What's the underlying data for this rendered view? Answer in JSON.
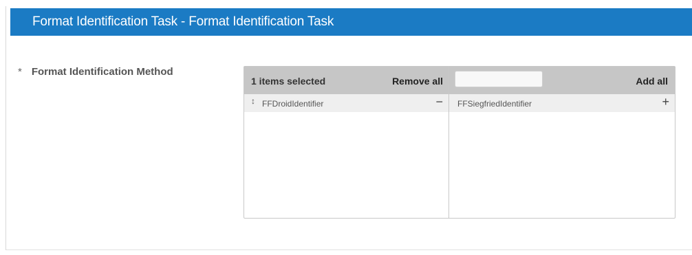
{
  "panel": {
    "title": "Format Identification Task - Format Identification Task"
  },
  "field": {
    "required_mark": "*",
    "label": "Format Identification Method"
  },
  "multiselect": {
    "selected": {
      "count_label": "1 items selected",
      "action_label": "Remove all",
      "items": [
        {
          "label": "FFDroidIdentifier",
          "drag_icon": "drag-handle-icon",
          "action_icon": "minus-icon"
        }
      ]
    },
    "available": {
      "search_placeholder": "",
      "search_value": "",
      "action_label": "Add all",
      "items": [
        {
          "label": "FFSiegfriedIdentifier",
          "action_icon": "plus-icon"
        }
      ]
    }
  },
  "colors": {
    "header_bg": "#1b7bc4",
    "column_head_bg": "#c6c6c6",
    "item_bg": "#efefef"
  }
}
